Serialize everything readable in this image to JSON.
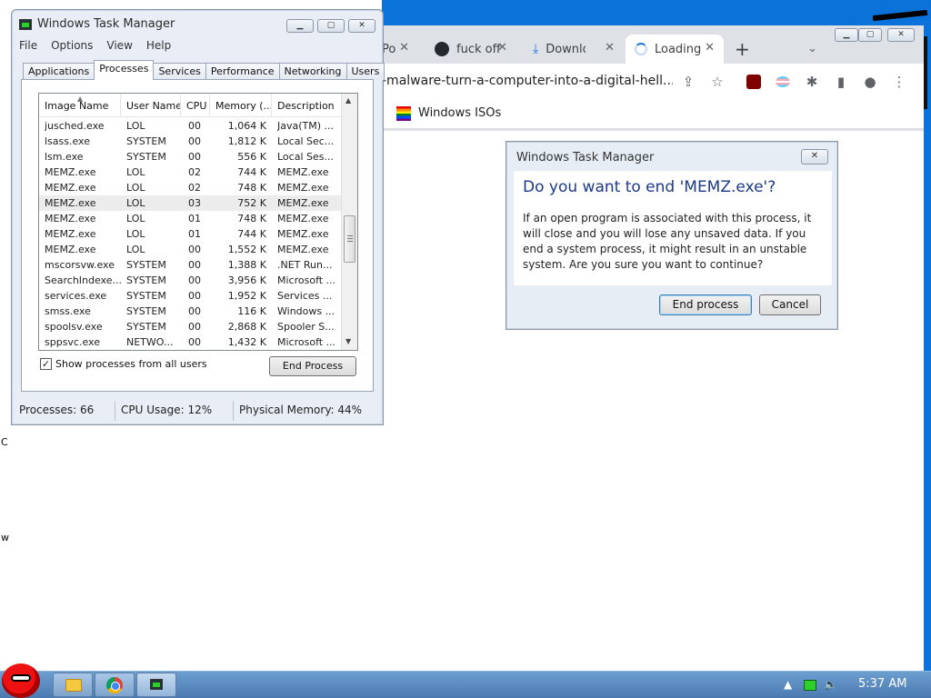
{
  "chrome": {
    "tabs": [
      {
        "label": "Po",
        "icon": "page-icon"
      },
      {
        "label": "fuck off",
        "icon": "github-icon"
      },
      {
        "label": "Downlo",
        "icon": "download-icon"
      },
      {
        "label": "Loading",
        "icon": "spinner-icon"
      }
    ],
    "url": "-malware-turn-a-computer-into-a-digital-hell...",
    "bookmark": "Windows ISOs"
  },
  "taskmanager": {
    "title": "Windows Task Manager",
    "menu": [
      "File",
      "Options",
      "View",
      "Help"
    ],
    "tabs": [
      "Applications",
      "Processes",
      "Services",
      "Performance",
      "Networking",
      "Users"
    ],
    "active_tab": "Processes",
    "columns": [
      "Image Name",
      "User Name",
      "CPU",
      "Memory (...",
      "Description"
    ],
    "rows": [
      {
        "image": "jusched.exe",
        "user": "LOL",
        "cpu": "00",
        "mem": "1,064 K",
        "desc": "Java(TM) ..."
      },
      {
        "image": "lsass.exe",
        "user": "SYSTEM",
        "cpu": "00",
        "mem": "1,812 K",
        "desc": "Local Sec..."
      },
      {
        "image": "lsm.exe",
        "user": "SYSTEM",
        "cpu": "00",
        "mem": "556 K",
        "desc": "Local Ses..."
      },
      {
        "image": "MEMZ.exe",
        "user": "LOL",
        "cpu": "02",
        "mem": "744 K",
        "desc": "MEMZ.exe"
      },
      {
        "image": "MEMZ.exe",
        "user": "LOL",
        "cpu": "02",
        "mem": "748 K",
        "desc": "MEMZ.exe"
      },
      {
        "image": "MEMZ.exe",
        "user": "LOL",
        "cpu": "03",
        "mem": "752 K",
        "desc": "MEMZ.exe"
      },
      {
        "image": "MEMZ.exe",
        "user": "LOL",
        "cpu": "01",
        "mem": "748 K",
        "desc": "MEMZ.exe"
      },
      {
        "image": "MEMZ.exe",
        "user": "LOL",
        "cpu": "01",
        "mem": "744 K",
        "desc": "MEMZ.exe"
      },
      {
        "image": "MEMZ.exe",
        "user": "LOL",
        "cpu": "00",
        "mem": "1,552 K",
        "desc": "MEMZ.exe"
      },
      {
        "image": "mscorsvw.exe",
        "user": "SYSTEM",
        "cpu": "00",
        "mem": "1,388 K",
        "desc": ".NET Run..."
      },
      {
        "image": "SearchIndexe...",
        "user": "SYSTEM",
        "cpu": "00",
        "mem": "3,956 K",
        "desc": "Microsoft ..."
      },
      {
        "image": "services.exe",
        "user": "SYSTEM",
        "cpu": "00",
        "mem": "1,952 K",
        "desc": "Services ..."
      },
      {
        "image": "smss.exe",
        "user": "SYSTEM",
        "cpu": "00",
        "mem": "116 K",
        "desc": "Windows ..."
      },
      {
        "image": "spoolsv.exe",
        "user": "SYSTEM",
        "cpu": "00",
        "mem": "2,868 K",
        "desc": "Spooler S..."
      },
      {
        "image": "sppsvc.exe",
        "user": "NETWO...",
        "cpu": "00",
        "mem": "1,432 K",
        "desc": "Microsoft ..."
      }
    ],
    "selected_row": 5,
    "show_all_label": "Show processes from all users",
    "show_all_checked": true,
    "end_process_label": "End Process",
    "status": {
      "processes": "Processes: 66",
      "cpu": "CPU Usage: 12%",
      "memory": "Physical Memory: 44%"
    }
  },
  "dialog": {
    "title": "Windows Task Manager",
    "question": "Do you want to end 'MEMZ.exe'?",
    "message": "If an open program is associated with this process, it will close and you will lose any unsaved data. If you end a system process, it might result in an unstable system. Are you sure you want to continue?",
    "end_label": "End process",
    "cancel_label": "Cancel"
  },
  "taskbar": {
    "clock": "5:37 AM"
  },
  "colors": {
    "desktop": "#0a72d8",
    "dialog_heading": "#1a3a8a"
  }
}
